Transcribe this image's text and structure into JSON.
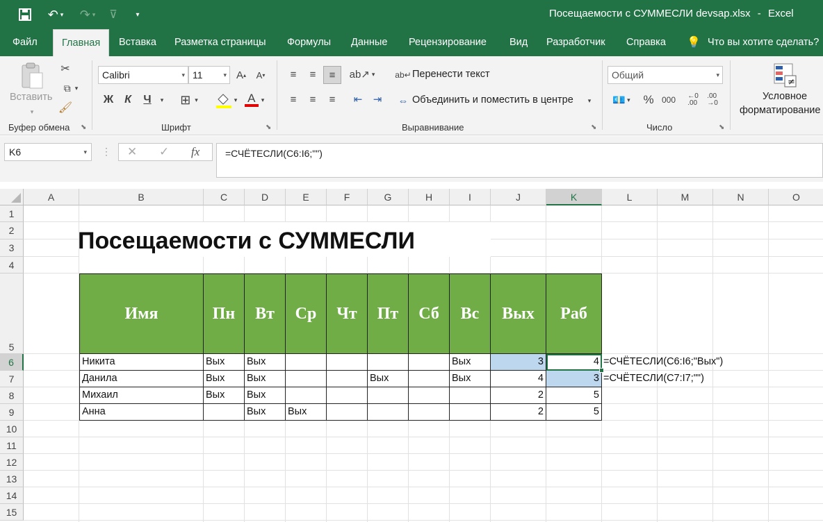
{
  "app": {
    "document_title": "Посещаемости с СУММЕСЛИ devsap.xlsx",
    "title_separator": "-",
    "app_name": "Excel"
  },
  "tabs": [
    {
      "label": "Файл"
    },
    {
      "label": "Главная"
    },
    {
      "label": "Вставка"
    },
    {
      "label": "Разметка страницы"
    },
    {
      "label": "Формулы"
    },
    {
      "label": "Данные"
    },
    {
      "label": "Рецензирование"
    },
    {
      "label": "Вид"
    },
    {
      "label": "Разработчик"
    },
    {
      "label": "Справка"
    }
  ],
  "tell_me": "Что вы хотите сделать?",
  "ribbon": {
    "clipboard": {
      "paste_label": "Вставить",
      "group_label": "Буфер обмена"
    },
    "font": {
      "font_name": "Calibri",
      "font_size": "11",
      "bold": "Ж",
      "italic": "К",
      "underline": "Ч",
      "increase": "A",
      "decrease": "A",
      "font_color_glyph": "A",
      "group_label": "Шрифт"
    },
    "alignment": {
      "wrap_text": "Перенести текст",
      "merge_center": "Объединить и поместить в центре",
      "group_label": "Выравнивание"
    },
    "number": {
      "format": "Общий",
      "percent": "%",
      "thousands": "000",
      "group_label": "Число"
    },
    "styles": {
      "conditional_line1": "Условное",
      "conditional_line2": "форматирование"
    }
  },
  "formula_bar": {
    "name_box": "K6",
    "fx_label": "fx",
    "formula": "=СЧЁТЕСЛИ(C6:I6;\"\")"
  },
  "sheet": {
    "columns": [
      "A",
      "B",
      "C",
      "D",
      "E",
      "F",
      "G",
      "H",
      "I",
      "J",
      "K",
      "L",
      "M",
      "N",
      "O"
    ],
    "rows": [
      "1",
      "2",
      "3",
      "4",
      "5",
      "6",
      "7",
      "8",
      "9",
      "10",
      "11",
      "12",
      "13",
      "14",
      "15"
    ],
    "title": "Посещаемости с СУММЕСЛИ",
    "table_headers": [
      "Имя",
      "Пн",
      "Вт",
      "Ср",
      "Чт",
      "Пт",
      "Сб",
      "Вс",
      "Вых",
      "Раб"
    ],
    "table_rows": [
      [
        "Никита",
        "Вых",
        "Вых",
        "",
        "",
        "",
        "",
        "Вых",
        "3",
        "4"
      ],
      [
        "Данила",
        "Вых",
        "Вых",
        "",
        "",
        "Вых",
        "",
        "Вых",
        "4",
        "3"
      ],
      [
        "Михаил",
        "Вых",
        "Вых",
        "",
        "",
        "",
        "",
        "",
        "2",
        "5"
      ],
      [
        " Анна",
        "",
        "Вых",
        "Вых",
        "",
        "",
        "",
        "",
        "2",
        "5"
      ]
    ],
    "notes": [
      "=СЧЁТЕСЛИ(C6:I6;\"Вых\")",
      "=СЧЁТЕСЛИ(C7:I7;\"\")"
    ],
    "header_fill": "#70ad47",
    "highlight_fill": "#bdd7ee",
    "selected_column": "K",
    "selected_row": "6"
  }
}
